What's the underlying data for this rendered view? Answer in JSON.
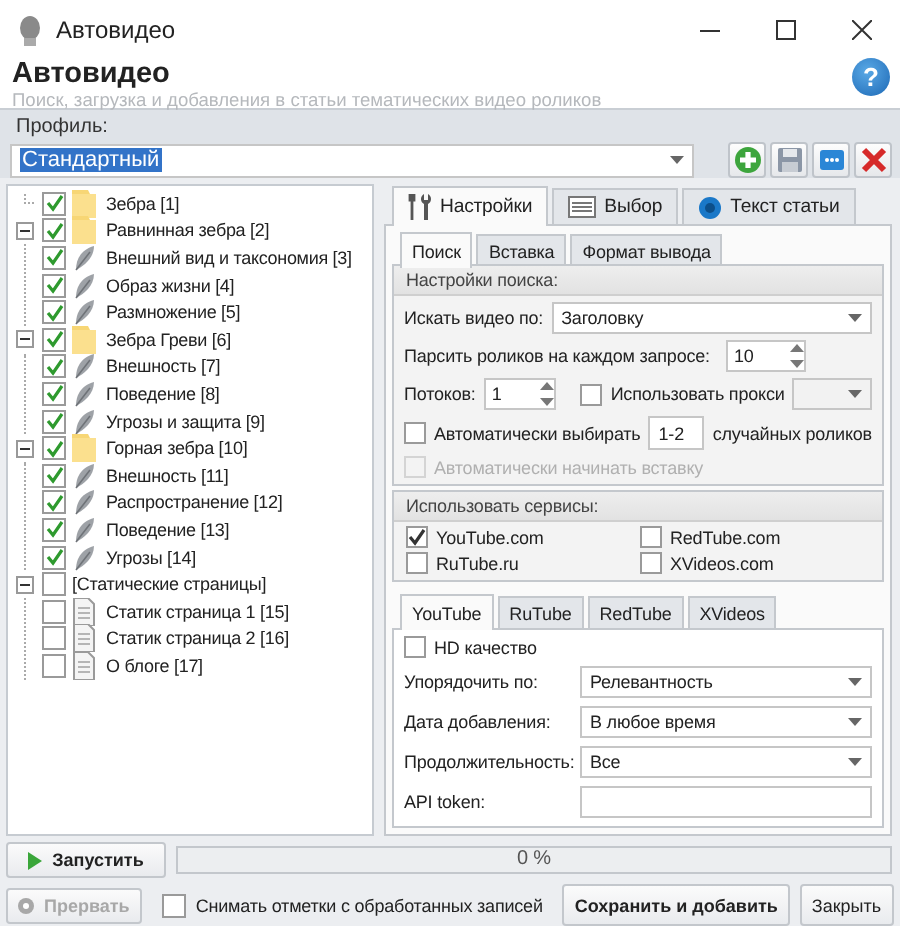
{
  "window": {
    "title": "Автовидео"
  },
  "header": {
    "title": "Автовидео",
    "subtitle": "Поиск, загрузка и добавления в статьи тематических видео роликов",
    "help": "?"
  },
  "profile": {
    "label": "Профиль:",
    "value": "Стандартный"
  },
  "tree": [
    {
      "label": "Зебра [1]",
      "kind": "folder",
      "checked": true
    },
    {
      "label": "Равнинная зебра [2]",
      "kind": "folder",
      "checked": true,
      "expanded": true,
      "children": [
        {
          "label": "Внешний вид и таксономия [3]",
          "kind": "article",
          "checked": true
        },
        {
          "label": "Образ жизни [4]",
          "kind": "article",
          "checked": true
        },
        {
          "label": "Размножение [5]",
          "kind": "article",
          "checked": true
        }
      ]
    },
    {
      "label": "Зебра Греви [6]",
      "kind": "folder",
      "checked": true,
      "expanded": true,
      "children": [
        {
          "label": "Внешность [7]",
          "kind": "article",
          "checked": true
        },
        {
          "label": "Поведение [8]",
          "kind": "article",
          "checked": true
        },
        {
          "label": "Угрозы и защита [9]",
          "kind": "article",
          "checked": true
        }
      ]
    },
    {
      "label": "Горная зебра [10]",
      "kind": "folder",
      "checked": true,
      "expanded": true,
      "children": [
        {
          "label": "Внешность [11]",
          "kind": "article",
          "checked": true
        },
        {
          "label": "Распространение [12]",
          "kind": "article",
          "checked": true
        },
        {
          "label": "Поведение [13]",
          "kind": "article",
          "checked": true
        },
        {
          "label": "Угрозы [14]",
          "kind": "article",
          "checked": true
        }
      ]
    },
    {
      "label": "[Статические страницы]",
      "kind": "group",
      "checked": false,
      "expanded": true,
      "children": [
        {
          "label": "Статик страница 1 [15]",
          "kind": "page",
          "checked": false
        },
        {
          "label": "Статик страница 2 [16]",
          "kind": "page",
          "checked": false
        },
        {
          "label": "О блоге [17]",
          "kind": "page",
          "checked": false
        }
      ]
    }
  ],
  "tabs": [
    {
      "label": "Настройки",
      "selected": true
    },
    {
      "label": "Выбор",
      "selected": false
    },
    {
      "label": "Текст статьи",
      "selected": false
    }
  ],
  "subtabs": [
    {
      "label": "Поиск",
      "selected": true
    },
    {
      "label": "Вставка",
      "selected": false
    },
    {
      "label": "Формат вывода",
      "selected": false
    }
  ],
  "search_settings": {
    "title": "Настройки поиска:",
    "search_by": {
      "label": "Искать видео по:",
      "value": "Заголовку"
    },
    "per_query": {
      "label": "Парсить роликов на каждом запросе:",
      "value": "10"
    },
    "threads": {
      "label": "Потоков:",
      "value": "1"
    },
    "proxy": {
      "label": "Использовать прокси",
      "checked": false
    },
    "auto_pick": {
      "label_before": "Автоматически выбирать",
      "value": "1-2",
      "label_after": "случайных роликов",
      "checked": false
    },
    "auto_insert": {
      "label": "Автоматически начинать вставку",
      "checked": false,
      "disabled": true
    }
  },
  "services": {
    "title": "Использовать сервисы:",
    "items": [
      {
        "label": "YouTube.com",
        "checked": true
      },
      {
        "label": "RedTube.com",
        "checked": false
      },
      {
        "label": "RuTube.ru",
        "checked": false
      },
      {
        "label": "XVideos.com",
        "checked": false
      }
    ]
  },
  "service_tabs": [
    {
      "label": "YouTube",
      "selected": true
    },
    {
      "label": "RuTube",
      "selected": false
    },
    {
      "label": "RedTube",
      "selected": false
    },
    {
      "label": "XVideos",
      "selected": false
    }
  ],
  "youtube": {
    "hd": {
      "label": "HD качество",
      "checked": false
    },
    "fields": [
      {
        "label": "Упорядочить по:",
        "kind": "select",
        "value": "Релевантность"
      },
      {
        "label": "Дата добавления:",
        "kind": "select",
        "value": "В любое время"
      },
      {
        "label": "Продолжительность:",
        "kind": "select",
        "value": "Все"
      },
      {
        "label": "API token:",
        "kind": "text"
      }
    ]
  },
  "bottom": {
    "start": {
      "label": "Запустить",
      "disabled": false
    },
    "progress": {
      "level": 0,
      "text": "0 %"
    },
    "stop": {
      "label": "Прервать",
      "disabled": true
    },
    "uncheck": {
      "label": "Снимать отметки с обработанных записей",
      "checked": false
    },
    "save": "Сохранить и добавить",
    "close": "Закрыть"
  }
}
